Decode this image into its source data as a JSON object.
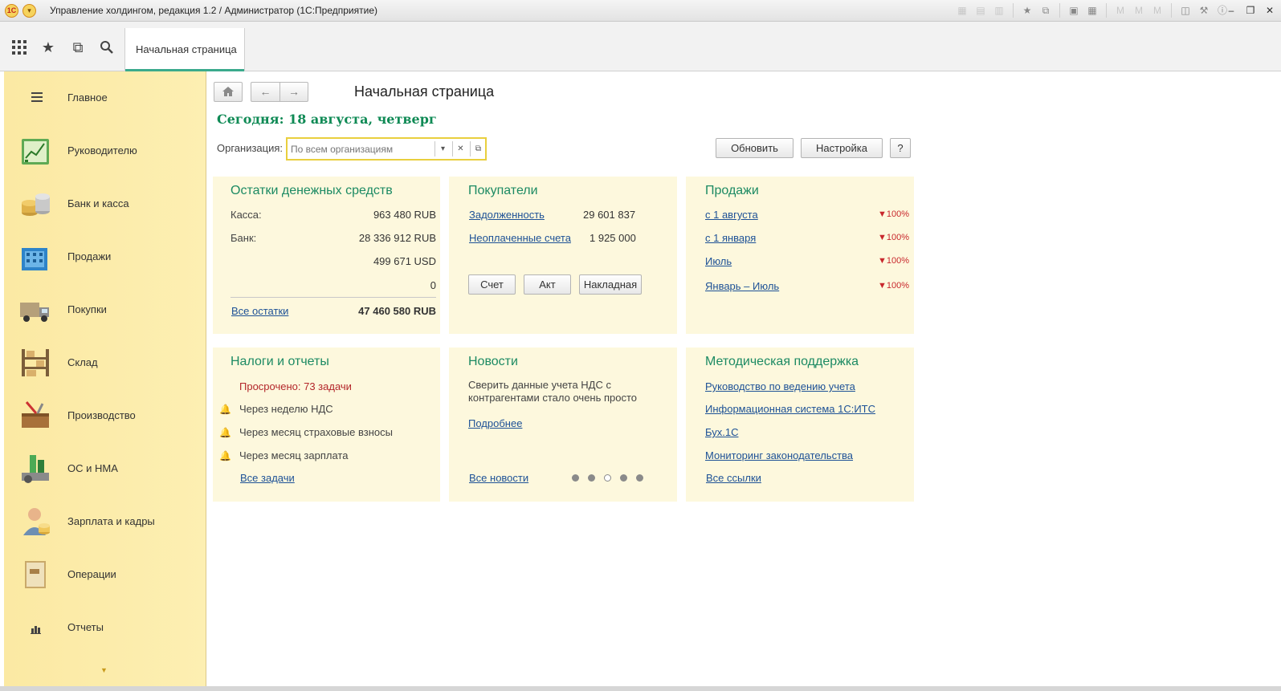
{
  "window": {
    "title": "Управление холдингом, редакция 1.2 / Администратор  (1С:Предприятие)",
    "logo": "1C"
  },
  "tabs": {
    "home_label": "Начальная страница"
  },
  "sidebar": {
    "items": [
      {
        "label": "Главное",
        "icon": "menu-icon"
      },
      {
        "label": "Руководителю",
        "icon": "chart-icon"
      },
      {
        "label": "Банк и касса",
        "icon": "coins-icon"
      },
      {
        "label": "Продажи",
        "icon": "building-icon"
      },
      {
        "label": "Покупки",
        "icon": "truck-icon"
      },
      {
        "label": "Склад",
        "icon": "warehouse-icon"
      },
      {
        "label": "Производство",
        "icon": "toolbox-icon"
      },
      {
        "label": "ОС и НМА",
        "icon": "assets-icon"
      },
      {
        "label": "Зарплата и кадры",
        "icon": "employee-icon"
      },
      {
        "label": "Операции",
        "icon": "ledger-icon"
      },
      {
        "label": "Отчеты",
        "icon": "bar-chart-icon"
      }
    ]
  },
  "main": {
    "page_title": "Начальная страница",
    "today": "Сегодня: 18 августа, четверг",
    "org_label": "Организация:",
    "org_placeholder": "По всем организациям",
    "refresh_label": "Обновить",
    "settings_label": "Настройка",
    "help_label": "?"
  },
  "cash": {
    "title": "Остатки денежных средств",
    "kassa_label": "Касса:",
    "kassa_value": "963 480 RUB",
    "bank_label": "Банк:",
    "bank_value": "28 336 912 RUB",
    "usd_value": "499 671 USD",
    "zero_value": "0",
    "all_link": "Все остатки",
    "total": "47 460 580 RUB"
  },
  "buyers": {
    "title": "Покупатели",
    "debt_link": "Задолженность",
    "debt_value": "29 601 837",
    "unpaid_link": "Неоплаченные счета",
    "unpaid_value": "1 925 000",
    "btn_invoice": "Счет",
    "btn_act": "Акт",
    "btn_waybill": "Накладная"
  },
  "sales": {
    "title": "Продажи",
    "rows": [
      {
        "label": "с 1 августа",
        "pct": "▼100%"
      },
      {
        "label": "с 1 января",
        "pct": "▼100%"
      },
      {
        "label": "Июль",
        "pct": "▼100%"
      },
      {
        "label": "Январь – Июль",
        "pct": "▼100%"
      }
    ]
  },
  "taxes": {
    "title": "Налоги и отчеты",
    "overdue": "Просрочено: 73 задачи",
    "items": [
      "Через неделю НДС",
      "Через месяц страховые взносы",
      "Через месяц зарплата"
    ],
    "all_link": "Все задачи"
  },
  "news": {
    "title": "Новости",
    "text": "Сверить данные учета НДС с контрагентами стало очень просто",
    "more_link": "Подробнее",
    "all_link": "Все новости",
    "active_dot": 3
  },
  "support": {
    "title": "Методическая поддержка",
    "links": [
      "Руководство по ведению учета",
      "Информационная система 1С:ИТС",
      "Бух.1С",
      "Мониторинг законодательства"
    ],
    "all_link": "Все ссылки"
  },
  "colors": {
    "accent_green": "#1c8a63",
    "panel_bg": "#fdf8dd",
    "sidebar_bg": "#fdefb2",
    "link_blue": "#1d5196",
    "alert_red": "#c8282d"
  }
}
